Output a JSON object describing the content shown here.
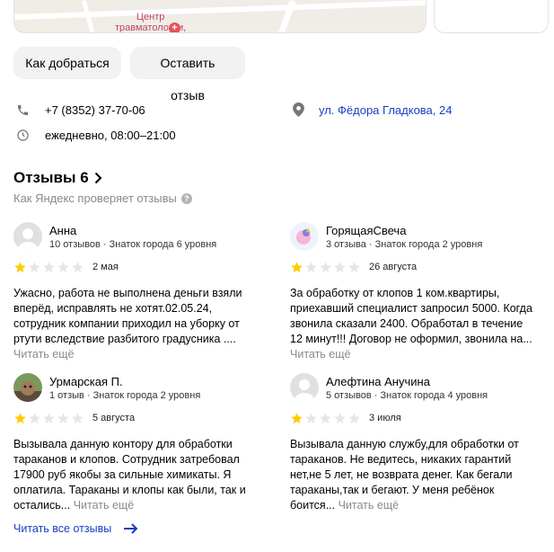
{
  "map": {
    "poi_label": "Центр\nтравматологии,"
  },
  "actions": {
    "route_label": "Как добраться",
    "review_label": "Оставить отзыв"
  },
  "contacts": {
    "phone": "+7 (8352) 37-70-06",
    "hours": "ежедневно, 08:00–21:00",
    "address": "ул. Фёдора Гладкова, 24"
  },
  "reviews": {
    "title": "Отзывы 6",
    "check_text": "Как Яндекс проверяет отзывы",
    "all_link": "Читать все отзывы",
    "more_label": "Читать ещё",
    "star_color": "#fc0",
    "star_empty_color": "#e6e6e6",
    "items": [
      {
        "name": "Анна",
        "meta": "10 отзывов · Знаток города 6 уровня",
        "rating": 1,
        "date": "2 мая",
        "text": "Ужасно, работа не выполнена деньги взяли вперёд, исправлять не хотят.02.05.24, сотрудник компании приходил на уборку от ртути вследствие разбитого градусника ...."
      },
      {
        "name": "ГорящаяСвеча",
        "meta": "3 отзыва · Знаток города 2 уровня",
        "rating": 1,
        "date": "26 августа",
        "text": "За обработку от клопов 1 ком.квартиры, приехавший специалист запросил 5000. Когда звонила сказали 2400. Обработал в течение 12 минут!!! Договор не оформил, звонила на..."
      },
      {
        "name": "Урмарская П.",
        "meta": "1 отзыв · Знаток города 2 уровня",
        "rating": 1,
        "date": "5 августа",
        "text": "Вызывала данную контору для обработки тараканов и клопов. Сотрудник затребовал 17900 руб якобы за сильные химикаты. Я оплатила. Тараканы и клопы как были, так и остались..."
      },
      {
        "name": "Алефтина Анучина",
        "meta": "5 отзывов · Знаток города 4 уровня",
        "rating": 1,
        "date": "3 июля",
        "text": "Вызывала данную службу,для обработки от тараканов. Не ведитесь, никаких гарантий нет,не 5 лет, не возврата денег. Как бегали тараканы,так и бегают. У меня ребёнок боится..."
      }
    ]
  }
}
